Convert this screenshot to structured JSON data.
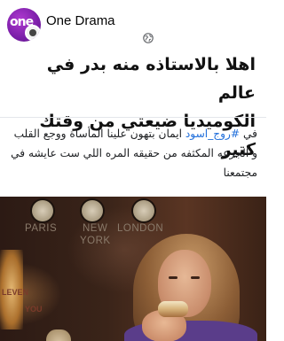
{
  "post": {
    "page_name": "One Drama",
    "avatar_text": "one",
    "privacy_icon": "globe-icon",
    "headline_line1": "اهلا بالاستاذه منه بدر في عالم",
    "headline_line2": "الكوميديا ضيعتي من وقتك كتير",
    "body_prefix": "في ",
    "hashtag": "#روج_اسود",
    "body_rest": " ايمان بتهون علينا المأساة ووجع القلب و الجرعه المكثفه من حقيقه المره اللي ست عايشه في مجتمعنا"
  },
  "media": {
    "clock_labels": [
      "PARIS",
      "NEW",
      "YORK",
      "LONDON"
    ],
    "sign_text": [
      "LEVEN",
      "YOU"
    ]
  },
  "colors": {
    "hashtag": "#216fdb",
    "avatar": "#7a1ea8",
    "text": "#111111"
  }
}
